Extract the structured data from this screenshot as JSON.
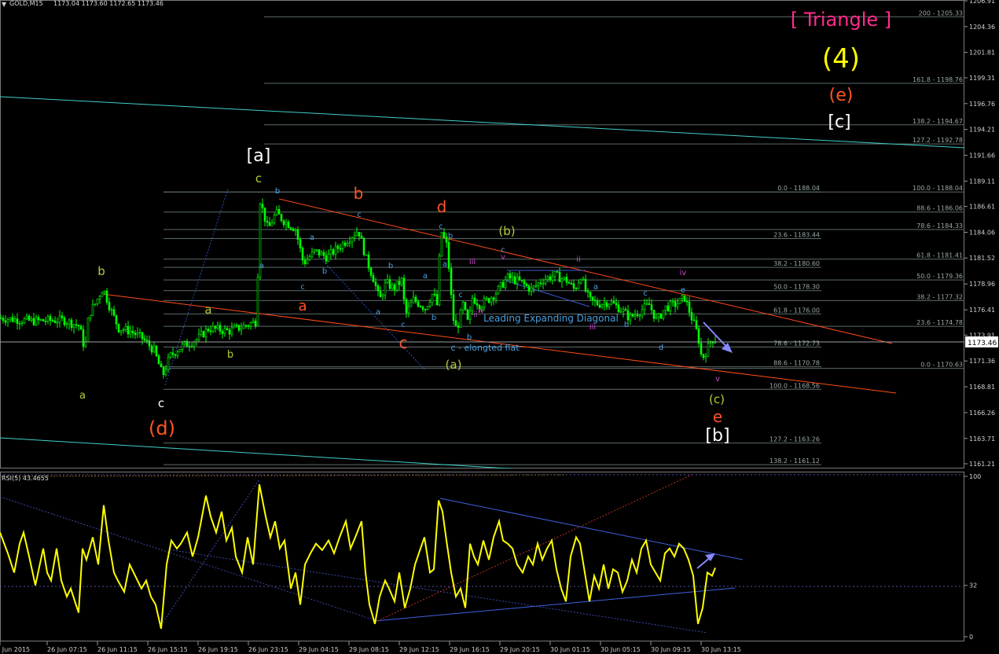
{
  "header": {
    "symbol": "GOLD,M15",
    "ohlc": "1173.04 1173.60 1172.65 1173.46"
  },
  "rsi_header": "RSI(5) 43.4655",
  "current_price": "1173.46",
  "colors": {
    "background": "#000000",
    "candles": "#00ff00",
    "rsi": "#ffff00",
    "channel": "#ff4a1a",
    "cyan_line": "#40d0c8",
    "fib": "#9aa8a8",
    "waves_green": "#b5cc3a",
    "waves_orange": "#ff5522",
    "waves_cyan": "#4aa0e0",
    "waves_magenta": "#cc44cc",
    "triangle": "#ff2d8c"
  },
  "chart_data": [
    {
      "type": "candlestick",
      "title": "GOLD,M15",
      "ylim": [
        1159.9,
        1208.0
      ],
      "y_ticks": [
        "1206.91",
        "1204.36",
        "1201.81",
        "1199.31",
        "1196.76",
        "1194.21",
        "1191.66",
        "1189.11",
        "1186.61",
        "1184.06",
        "1181.52",
        "1178.96",
        "1176.41",
        "1173.91",
        "1171.36",
        "1168.81",
        "1166.26",
        "1163.71",
        "1161.21"
      ],
      "x_ticks": [
        "26 Jun 2015",
        "26 Jun 07:15",
        "26 Jun 11:15",
        "26 Jun 15:15",
        "26 Jun 19:15",
        "26 Jun 23:15",
        "29 Jun 04:15",
        "29 Jun 08:15",
        "29 Jun 12:15",
        "29 Jun 16:15",
        "29 Jun 20:15",
        "30 Jun 01:15",
        "30 Jun 05:15",
        "30 Jun 09:15",
        "30 Jun 13:15"
      ],
      "price_path": [
        {
          "t": 0,
          "v": 1175.6
        },
        {
          "t": 40,
          "v": 1175.3
        },
        {
          "t": 80,
          "v": 1175.4
        },
        {
          "t": 100,
          "v": 1174.8
        },
        {
          "t": 107,
          "v": 1172.4
        },
        {
          "t": 112,
          "v": 1176.0
        },
        {
          "t": 120,
          "v": 1177.0
        },
        {
          "t": 130,
          "v": 1178.6
        },
        {
          "t": 140,
          "v": 1176.4
        },
        {
          "t": 150,
          "v": 1174.6
        },
        {
          "t": 165,
          "v": 1174.3
        },
        {
          "t": 180,
          "v": 1173.6
        },
        {
          "t": 195,
          "v": 1172.4
        },
        {
          "t": 206,
          "v": 1169.9
        },
        {
          "t": 215,
          "v": 1171.8
        },
        {
          "t": 230,
          "v": 1172.8
        },
        {
          "t": 250,
          "v": 1173.5
        },
        {
          "t": 265,
          "v": 1174.6
        },
        {
          "t": 290,
          "v": 1174.3
        },
        {
          "t": 310,
          "v": 1174.8
        },
        {
          "t": 325,
          "v": 1175.3
        },
        {
          "t": 330,
          "v": 1187.2
        },
        {
          "t": 340,
          "v": 1184.3
        },
        {
          "t": 350,
          "v": 1186.0
        },
        {
          "t": 360,
          "v": 1185.2
        },
        {
          "t": 375,
          "v": 1184.4
        },
        {
          "t": 385,
          "v": 1181.0
        },
        {
          "t": 400,
          "v": 1182.2
        },
        {
          "t": 415,
          "v": 1181.6
        },
        {
          "t": 430,
          "v": 1182.6
        },
        {
          "t": 445,
          "v": 1183.6
        },
        {
          "t": 455,
          "v": 1184.3
        },
        {
          "t": 465,
          "v": 1181.4
        },
        {
          "t": 475,
          "v": 1179.3
        },
        {
          "t": 482,
          "v": 1177.3
        },
        {
          "t": 490,
          "v": 1179.1
        },
        {
          "t": 500,
          "v": 1178.5
        },
        {
          "t": 510,
          "v": 1179.3
        },
        {
          "t": 515,
          "v": 1175.9
        },
        {
          "t": 525,
          "v": 1177.4
        },
        {
          "t": 540,
          "v": 1176.6
        },
        {
          "t": 550,
          "v": 1178.1
        },
        {
          "t": 555,
          "v": 1176.9
        },
        {
          "t": 560,
          "v": 1184.3
        },
        {
          "t": 568,
          "v": 1182.6
        },
        {
          "t": 575,
          "v": 1175.7
        },
        {
          "t": 580,
          "v": 1174.4
        },
        {
          "t": 588,
          "v": 1176.9
        },
        {
          "t": 595,
          "v": 1174.9
        },
        {
          "t": 600,
          "v": 1177.6
        },
        {
          "t": 610,
          "v": 1176.9
        },
        {
          "t": 620,
          "v": 1177.4
        },
        {
          "t": 630,
          "v": 1178.1
        },
        {
          "t": 645,
          "v": 1179.6
        },
        {
          "t": 660,
          "v": 1179.2
        },
        {
          "t": 675,
          "v": 1178.4
        },
        {
          "t": 690,
          "v": 1179.4
        },
        {
          "t": 705,
          "v": 1179.8
        },
        {
          "t": 720,
          "v": 1179.3
        },
        {
          "t": 730,
          "v": 1178.4
        },
        {
          "t": 738,
          "v": 1179.8
        },
        {
          "t": 745,
          "v": 1178.0
        },
        {
          "t": 750,
          "v": 1177.3
        },
        {
          "t": 760,
          "v": 1177.0
        },
        {
          "t": 775,
          "v": 1177.2
        },
        {
          "t": 790,
          "v": 1176.4
        },
        {
          "t": 800,
          "v": 1175.6
        },
        {
          "t": 815,
          "v": 1176.4
        },
        {
          "t": 825,
          "v": 1176.9
        },
        {
          "t": 835,
          "v": 1175.3
        },
        {
          "t": 845,
          "v": 1176.6
        },
        {
          "t": 860,
          "v": 1177.0
        },
        {
          "t": 870,
          "v": 1177.6
        },
        {
          "t": 880,
          "v": 1175.4
        },
        {
          "t": 887,
          "v": 1173.9
        },
        {
          "t": 892,
          "v": 1171.5
        },
        {
          "t": 898,
          "v": 1172.4
        },
        {
          "t": 904,
          "v": 1173.5
        },
        {
          "t": 910,
          "v": 1173.5
        }
      ],
      "fibonacci_levels": [
        {
          "label": "200 - 1205.33",
          "v": 1205.33
        },
        {
          "label": "161.8 - 1198.76",
          "v": 1198.76
        },
        {
          "label": "138.2 - 1194.67",
          "v": 1194.67
        },
        {
          "label": "127.2 - 1192.78",
          "v": 1192.78
        },
        {
          "label": "0.0 - 1188.04",
          "v": 1188.04
        },
        {
          "label": "100.0 - 1188.04",
          "v": 1188.04
        },
        {
          "label": "88.6 - 1186.06",
          "v": 1186.06
        },
        {
          "label": "78.6 - 1184.33",
          "v": 1184.33
        },
        {
          "label": "23.6 - 1183.44",
          "v": 1183.44
        },
        {
          "label": "61.8 - 1181.41",
          "v": 1181.41
        },
        {
          "label": "38.2 - 1180.60",
          "v": 1180.6
        },
        {
          "label": "50.0 - 1179.36",
          "v": 1179.36
        },
        {
          "label": "50.0 - 1178.30",
          "v": 1178.3
        },
        {
          "label": "38.2 - 1177.32",
          "v": 1177.32
        },
        {
          "label": "61.8 - 1176.00",
          "v": 1176.0
        },
        {
          "label": "23.6 - 1174.78",
          "v": 1174.78
        },
        {
          "label": "78.6 - 1172.73",
          "v": 1172.73
        },
        {
          "label": "88.6 - 1170.78",
          "v": 1170.78
        },
        {
          "label": "0.0 - 1170.63",
          "v": 1170.63
        },
        {
          "label": "100.0 - 1168.56",
          "v": 1168.56
        },
        {
          "label": "127.2 - 1163.26",
          "v": 1163.26
        },
        {
          "label": "138.2 - 1161.12",
          "v": 1161.12
        }
      ],
      "annotations": [
        "[ Triangle ]",
        "(4)",
        "(e)",
        "[c]",
        "[a]",
        "(d)",
        "[b]",
        "(b)",
        "(a)",
        "(c)",
        "Leading Expanding Diagonal",
        "c - elongted flat",
        "a",
        "b",
        "c",
        "d",
        "e",
        "ii",
        "iii",
        "iv",
        "v"
      ]
    },
    {
      "type": "line",
      "title": "RSI(5) 43.4655",
      "ylim": [
        0,
        100
      ],
      "y_ticks": [
        "100",
        "32",
        "0"
      ],
      "series": [
        {
          "name": "RSI(5)",
          "values": [
            [
              0,
              65
            ],
            [
              10,
              52
            ],
            [
              18,
              40
            ],
            [
              25,
              58
            ],
            [
              30,
              65
            ],
            [
              38,
              48
            ],
            [
              45,
              32
            ],
            [
              55,
              55
            ],
            [
              60,
              40
            ],
            [
              65,
              35
            ],
            [
              72,
              55
            ],
            [
              78,
              35
            ],
            [
              85,
              25
            ],
            [
              90,
              30
            ],
            [
              100,
              15
            ],
            [
              105,
              55
            ],
            [
              110,
              48
            ],
            [
              118,
              62
            ],
            [
              125,
              45
            ],
            [
              132,
              82
            ],
            [
              138,
              60
            ],
            [
              145,
              40
            ],
            [
              150,
              35
            ],
            [
              158,
              28
            ],
            [
              165,
              45
            ],
            [
              172,
              38
            ],
            [
              180,
              30
            ],
            [
              186,
              35
            ],
            [
              192,
              25
            ],
            [
              198,
              20
            ],
            [
              205,
              5
            ],
            [
              212,
              45
            ],
            [
              218,
              60
            ],
            [
              225,
              55
            ],
            [
              230,
              58
            ],
            [
              238,
              65
            ],
            [
              245,
              50
            ],
            [
              252,
              62
            ],
            [
              262,
              88
            ],
            [
              268,
              75
            ],
            [
              275,
              65
            ],
            [
              282,
              78
            ],
            [
              288,
              60
            ],
            [
              295,
              68
            ],
            [
              300,
              50
            ],
            [
              308,
              40
            ],
            [
              315,
              62
            ],
            [
              322,
              45
            ],
            [
              330,
              95
            ],
            [
              338,
              75
            ],
            [
              344,
              62
            ],
            [
              350,
              72
            ],
            [
              356,
              55
            ],
            [
              362,
              60
            ],
            [
              370,
              30
            ],
            [
              376,
              40
            ],
            [
              382,
              20
            ],
            [
              388,
              45
            ],
            [
              395,
              52
            ],
            [
              402,
              58
            ],
            [
              410,
              54
            ],
            [
              418,
              60
            ],
            [
              425,
              52
            ],
            [
              432,
              62
            ],
            [
              440,
              72
            ],
            [
              446,
              55
            ],
            [
              452,
              62
            ],
            [
              460,
              72
            ],
            [
              465,
              40
            ],
            [
              470,
              20
            ],
            [
              477,
              8
            ],
            [
              483,
              25
            ],
            [
              490,
              35
            ],
            [
              495,
              30
            ],
            [
              502,
              22
            ],
            [
              508,
              40
            ],
            [
              515,
              18
            ],
            [
              522,
              30
            ],
            [
              528,
              45
            ],
            [
              535,
              55
            ],
            [
              540,
              62
            ],
            [
              547,
              40
            ],
            [
              552,
              42
            ],
            [
              558,
              85
            ],
            [
              563,
              78
            ],
            [
              568,
              60
            ],
            [
              574,
              40
            ],
            [
              580,
              25
            ],
            [
              586,
              30
            ],
            [
              592,
              18
            ],
            [
              598,
              58
            ],
            [
              603,
              50
            ],
            [
              608,
              45
            ],
            [
              615,
              60
            ],
            [
              622,
              48
            ],
            [
              628,
              62
            ],
            [
              635,
              72
            ],
            [
              640,
              60
            ],
            [
              646,
              58
            ],
            [
              652,
              55
            ],
            [
              658,
              45
            ],
            [
              665,
              40
            ],
            [
              672,
              50
            ],
            [
              678,
              45
            ],
            [
              684,
              58
            ],
            [
              690,
              48
            ],
            [
              696,
              55
            ],
            [
              702,
              60
            ],
            [
              708,
              42
            ],
            [
              714,
              30
            ],
            [
              720,
              22
            ],
            [
              726,
              50
            ],
            [
              733,
              62
            ],
            [
              738,
              58
            ],
            [
              744,
              40
            ],
            [
              750,
              22
            ],
            [
              756,
              38
            ],
            [
              762,
              30
            ],
            [
              768,
              45
            ],
            [
              774,
              30
            ],
            [
              780,
              42
            ],
            [
              786,
              40
            ],
            [
              792,
              28
            ],
            [
              798,
              35
            ],
            [
              804,
              48
            ],
            [
              810,
              40
            ],
            [
              816,
              55
            ],
            [
              822,
              60
            ],
            [
              828,
              45
            ],
            [
              834,
              40
            ],
            [
              840,
              35
            ],
            [
              846,
              52
            ],
            [
              852,
              55
            ],
            [
              858,
              50
            ],
            [
              864,
              58
            ],
            [
              870,
              55
            ],
            [
              876,
              48
            ],
            [
              882,
              38
            ],
            [
              888,
              8
            ],
            [
              894,
              18
            ],
            [
              900,
              40
            ],
            [
              906,
              38
            ],
            [
              910,
              43
            ]
          ]
        }
      ]
    }
  ]
}
